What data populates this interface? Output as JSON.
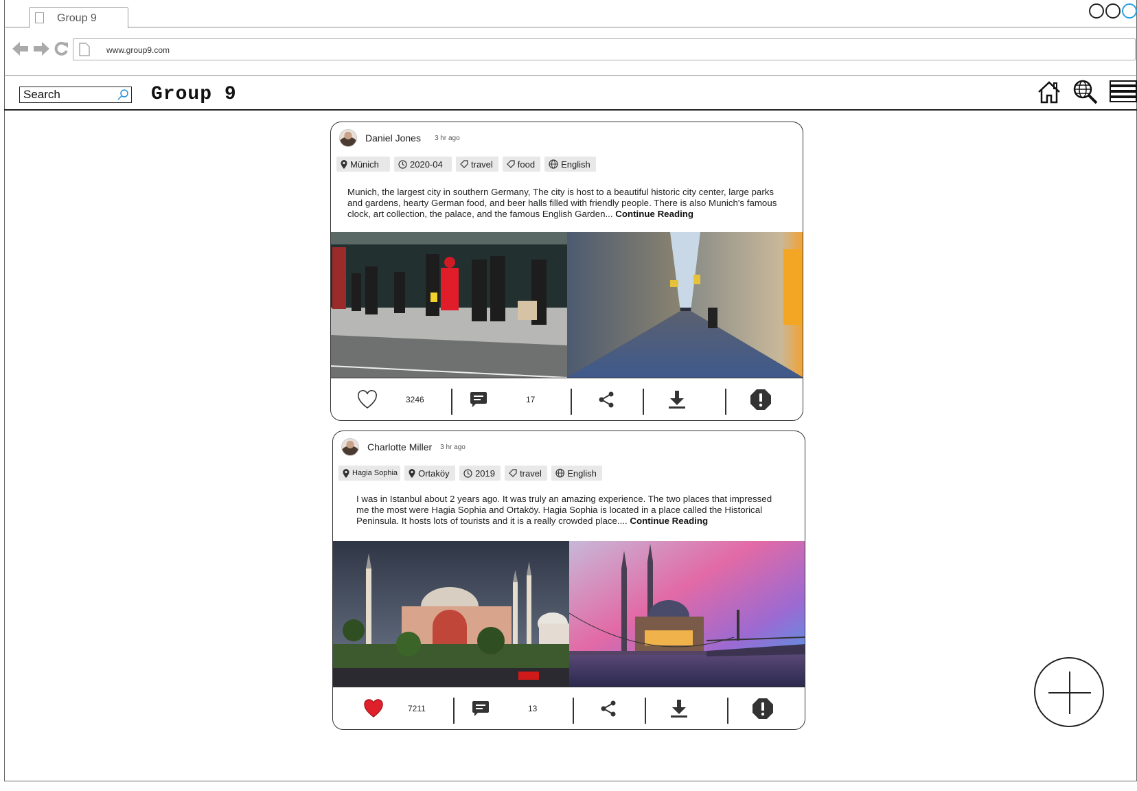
{
  "browser": {
    "tab_title": "Group 9",
    "url": "www.group9.com"
  },
  "header": {
    "search_placeholder": "Search",
    "brand": "Group 9",
    "icons": [
      "home-icon",
      "globe-search-icon",
      "menu-icon"
    ]
  },
  "posts": [
    {
      "author": "Daniel Jones",
      "time": "3 hr ago",
      "tags": [
        {
          "icon": "location-pin-icon",
          "label": "Münich"
        },
        {
          "icon": "clock-icon",
          "label": "2020-04"
        },
        {
          "icon": "tag-icon",
          "label": "travel"
        },
        {
          "icon": "tag-icon",
          "label": "food"
        },
        {
          "icon": "globe-icon",
          "label": "English"
        }
      ],
      "excerpt": "Munich, the largest city in southern Germany, The city is host to a beautiful historic city center, large parks and gardens, hearty German food, and beer halls filled with friendly people. There is also Munich's famous clock, art collection, the palace, and the famous English Garden...",
      "continue_label": "Continue Reading",
      "photos": [
        "street-pedestrians-photo",
        "shopping-arcade-photo"
      ],
      "likes": "3246",
      "liked": false,
      "comments": "17"
    },
    {
      "author": "Charlotte Miller",
      "time": "3 hr ago",
      "tags": [
        {
          "icon": "location-pin-icon",
          "label": "Hagia Sophia"
        },
        {
          "icon": "location-pin-icon",
          "label": "Ortaköy"
        },
        {
          "icon": "clock-icon",
          "label": "2019"
        },
        {
          "icon": "tag-icon",
          "label": "travel"
        },
        {
          "icon": "globe-icon",
          "label": "English"
        }
      ],
      "excerpt": "I was in Istanbul about 2 years ago. It was truly an amazing experience. The two places that impressed me the most were Hagia Sophia and Ortaköy. Hagia Sophia is located in a place called the Historical Peninsula. It hosts lots of tourists and it is a really crowded place....",
      "continue_label": "Continue Reading",
      "photos": [
        "hagia-sophia-photo",
        "ortakoy-mosque-photo"
      ],
      "likes": "7211",
      "liked": true,
      "comments": "13"
    }
  ],
  "colors": {
    "liked_heart": "#e0202a",
    "icon_dark": "#333333",
    "tag_bg": "#e8e8e8"
  }
}
